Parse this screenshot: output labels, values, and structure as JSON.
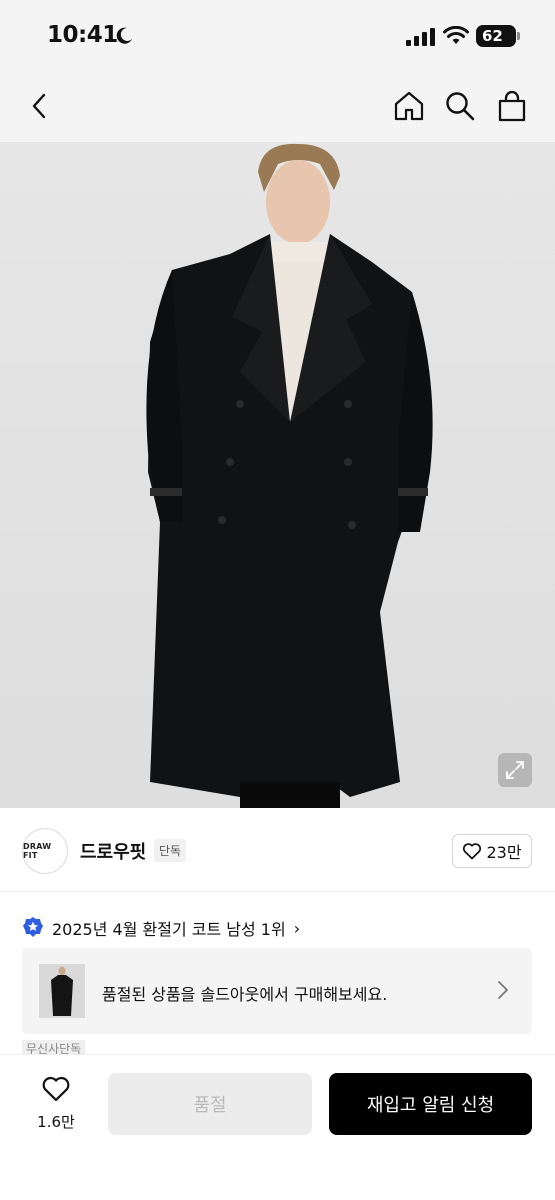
{
  "status": {
    "time": "10:41",
    "battery": "62",
    "icons": [
      "moon-icon",
      "signal-icon",
      "wifi-icon",
      "battery-icon"
    ]
  },
  "nav": {
    "icons": [
      "back-arrow-icon",
      "home-icon",
      "search-icon",
      "shopping-bag-icon"
    ]
  },
  "product": {
    "image_icon": "expand-icon"
  },
  "brand": {
    "logo_text": "DRAW FIT",
    "name": "드로우핏",
    "tag": "단독",
    "like_count": "23만"
  },
  "ranking": {
    "text": "2025년 4월 환절기 코트 남성 1위",
    "chevron": "›"
  },
  "soldout_banner": {
    "text": "품절된 상품을 솔드아웃에서 구매해보세요."
  },
  "partial_tag": "무신사단독",
  "bottom": {
    "like_count": "1.6만",
    "soldout_label": "품절",
    "restock_label": "재입고 알림 신청"
  },
  "colors": {
    "accent_primary": "#000000",
    "rank_badge": "#2f5fe0",
    "disabled_bg": "#ececec"
  }
}
